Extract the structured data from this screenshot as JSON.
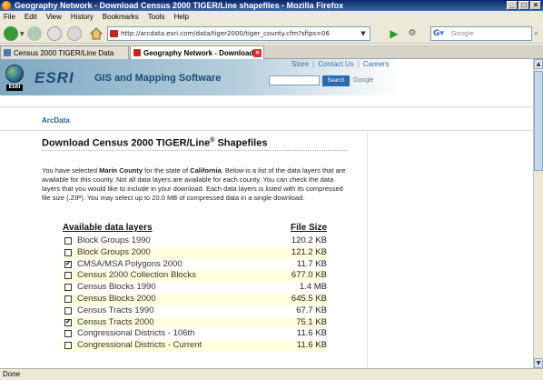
{
  "window": {
    "title": "Geography Network - Download Census 2000 TIGER/Line shapefiles - Mozilla Firefox"
  },
  "menu": [
    "File",
    "Edit",
    "View",
    "History",
    "Bookmarks",
    "Tools",
    "Help"
  ],
  "navbar": {
    "url": "http://arcdata.esri.com/data/tiger2000/tiger_county.cfm?sfips=06",
    "search_placeholder": "Google"
  },
  "tabs": [
    {
      "label": "Census 2000 TIGER/Line Data",
      "active": false
    },
    {
      "label": "Geography Network - Download ...",
      "active": true
    }
  ],
  "header": {
    "globe_label": "ESRI",
    "logo": "ESRI",
    "tagline": "GIS and Mapping Software",
    "links": [
      "Store",
      "Contact Us",
      "Careers"
    ],
    "search_button": "Search",
    "google": "Google"
  },
  "section": "ArcData",
  "page": {
    "title": "Download Census 2000 TIGER/Line",
    "title_sup": "®",
    "title_tail": " Shapefiles",
    "intro_1": "You have selected ",
    "county": "Marin County",
    "intro_2": " for the state of ",
    "state": "California",
    "intro_3": ". Below is a list of the data layers that are available for this county. Not all data layers are available for each county. You can check the data layers that you would like to include in your download. Each data layers is listed with its compressed file size (.ZIP). You may select up to 20.0 MB of compressed data in a single download."
  },
  "table": {
    "col_layers": "Available data layers",
    "col_size": "File Size",
    "rows": [
      {
        "label": "Block Groups 1990",
        "size": "120.2 KB",
        "checked": false
      },
      {
        "label": "Block Groups 2000",
        "size": "121.2 KB",
        "checked": false
      },
      {
        "label": "CMSA/MSA Polygons 2000",
        "size": "11.7 KB",
        "checked": true
      },
      {
        "label": "Census 2000 Collection Blocks",
        "size": "677.0 KB",
        "checked": false
      },
      {
        "label": "Census Blocks 1990",
        "size": "1.4 MB",
        "checked": false
      },
      {
        "label": "Census Blocks 2000",
        "size": "645.5 KB",
        "checked": false
      },
      {
        "label": "Census Tracts 1990",
        "size": "67.7 KB",
        "checked": false
      },
      {
        "label": "Census Tracts 2000",
        "size": "75.1 KB",
        "checked": true
      },
      {
        "label": "Congressional Districts - 106th",
        "size": "11.6 KB",
        "checked": false
      },
      {
        "label": "Congressional Districts - Current",
        "size": "11.6 KB",
        "checked": false
      }
    ]
  },
  "status": "Done"
}
